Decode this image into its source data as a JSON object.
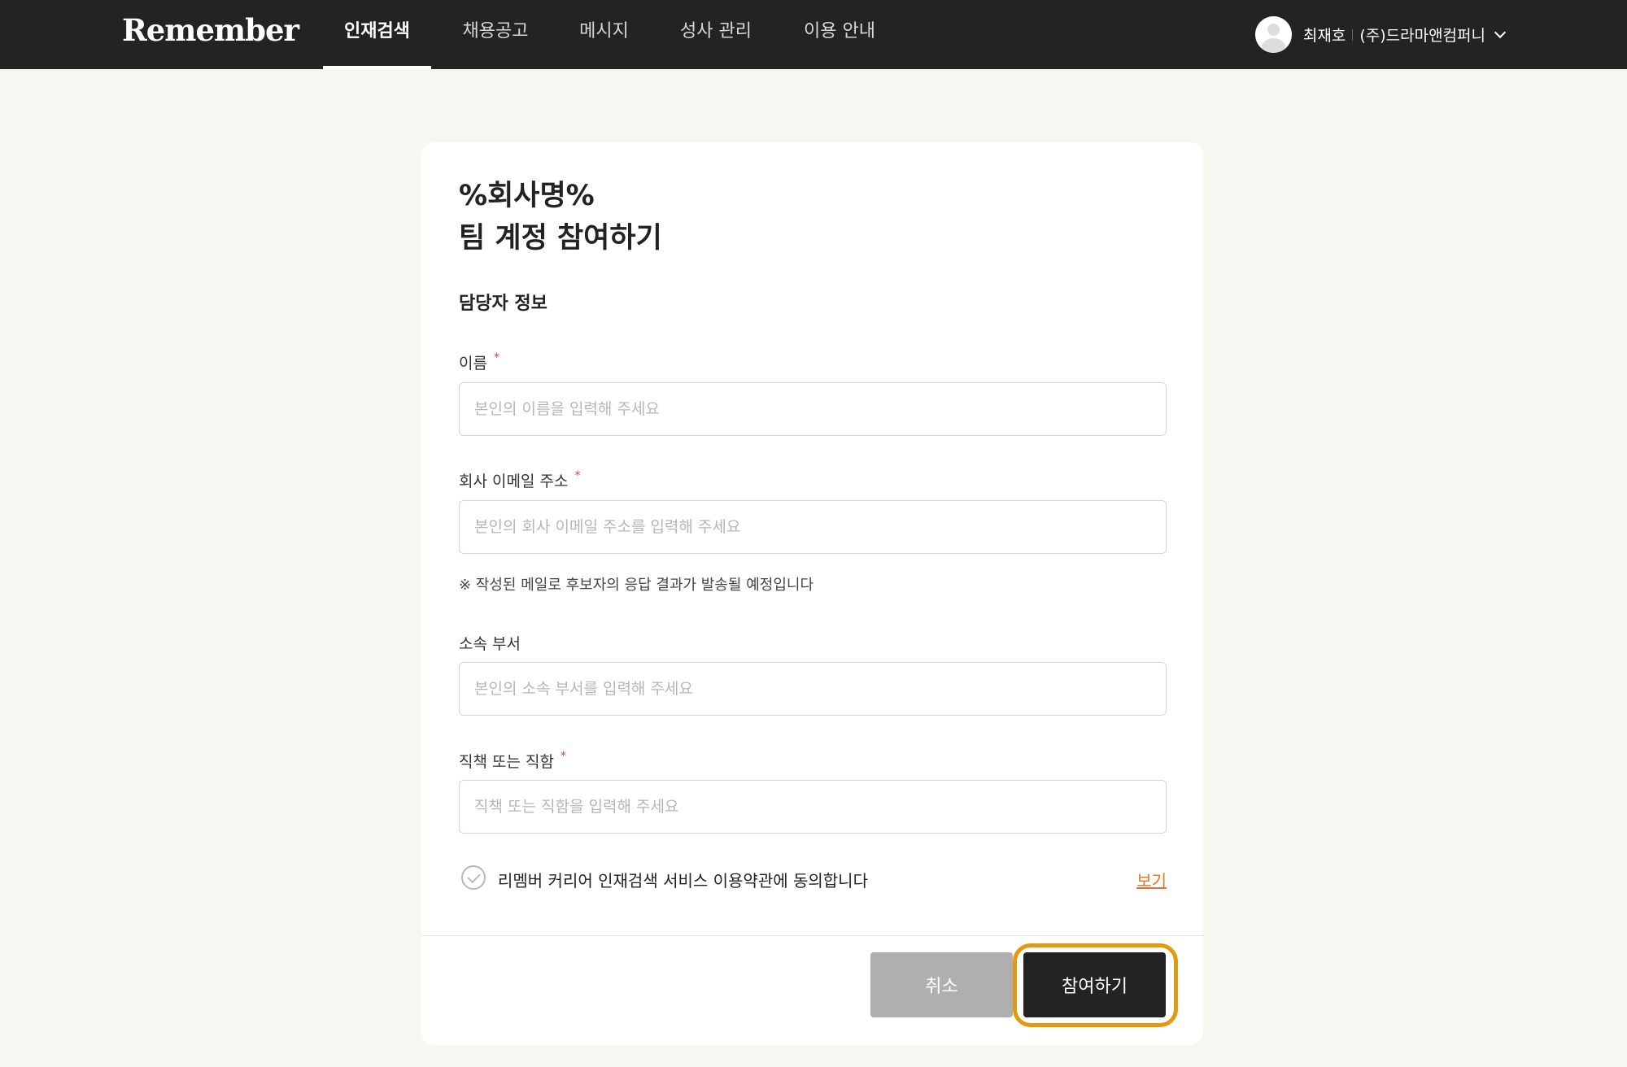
{
  "brand": {
    "logo_text": "Remember"
  },
  "nav": {
    "items": [
      {
        "label": "인재검색",
        "active": true
      },
      {
        "label": "채용공고",
        "active": false
      },
      {
        "label": "메시지",
        "active": false
      },
      {
        "label": "성사 관리",
        "active": false
      },
      {
        "label": "이용 안내",
        "active": false
      }
    ]
  },
  "user": {
    "name": "최재호",
    "company": "(주)드라마앤컴퍼니"
  },
  "form": {
    "title_line1": "%회사명%",
    "title_line2": "팀 계정 참여하기",
    "section_title": "담당자 정보",
    "required_mark": "*",
    "fields": [
      {
        "label": "이름",
        "required": true,
        "placeholder": "본인의 이름을 입력해 주세요",
        "value": ""
      },
      {
        "label": "회사 이메일 주소",
        "required": true,
        "placeholder": "본인의 회사 이메일 주소를 입력해 주세요",
        "value": ""
      },
      {
        "label": "소속 부서",
        "required": false,
        "placeholder": "본인의 소속 부서를 입력해 주세요",
        "value": ""
      },
      {
        "label": "직책 또는 직함",
        "required": true,
        "placeholder": "직책 또는 직함을 입력해 주세요",
        "value": ""
      }
    ],
    "email_note": "※ 작성된 메일로 후보자의 응답 결과가 발송될 예정입니다",
    "agree_text": "리멤버 커리어 인재검색 서비스 이용약관에 동의합니다",
    "agree_link": "보기",
    "cancel_label": "취소",
    "submit_label": "참여하기"
  },
  "colors": {
    "topbar": "#222322",
    "page_bg": "#f7f6f0",
    "required": "#e53b3b",
    "link": "#e2732e",
    "highlight": "#e39a12",
    "cancel_bg": "#afafaf",
    "submit_bg": "#222322"
  }
}
